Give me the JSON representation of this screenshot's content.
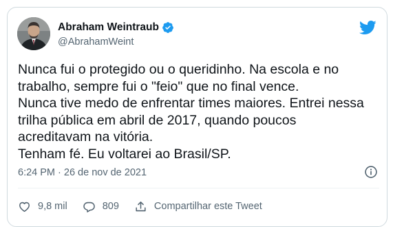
{
  "author": {
    "display_name": "Abraham Weintraub",
    "handle": "@AbrahamWeint",
    "avatar_icon": "user-avatar-photo",
    "verified_icon": "verified-badge-icon"
  },
  "tweet": {
    "lines": [
      "Nunca fui o protegido ou o queridinho. Na escola e no",
      "trabalho, sempre fui o \"feio\" que no final vence.",
      "Nunca tive medo de enfrentar times maiores. Entrei nessa",
      "trilha pública em abril de 2017, quando poucos",
      "acreditavam na vitória.",
      "Tenham fé. Eu voltarei ao Brasil/SP."
    ],
    "timestamp": "6:24 PM · 26 de nov de 2021"
  },
  "actions": {
    "likes": "9,8 mil",
    "replies": "809",
    "share_label": "Compartilhar este Tweet"
  },
  "colors": {
    "brand": "#1d9bf0",
    "text": "#0f1419",
    "secondary": "#536471",
    "border": "#cfd9de"
  }
}
